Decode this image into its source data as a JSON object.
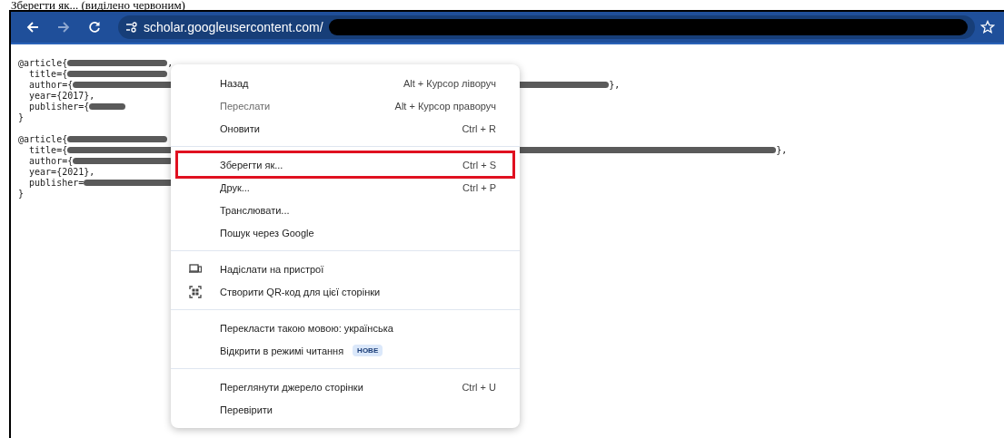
{
  "caption": "Зберегти як... (виділено червоним)",
  "toolbar": {
    "url": "scholar.googleusercontent.com/"
  },
  "code_entries": [
    [
      {
        "prefix": "@article{",
        "redacted": true,
        "suffix": ","
      },
      {
        "prefix": "  title={",
        "redacted": true
      },
      {
        "prefix": "  author={",
        "redacted": true,
        "suffix": "},"
      },
      {
        "prefix": "  year={2017},",
        "redacted": false
      },
      {
        "prefix": "  publisher={",
        "redacted": true
      },
      {
        "prefix": "}",
        "redacted": false
      }
    ],
    [
      {
        "prefix": "@article{",
        "redacted": true
      },
      {
        "prefix": "  title={",
        "redacted": true,
        "suffix": "},"
      },
      {
        "prefix": "  author={",
        "redacted": true
      },
      {
        "prefix": "  year={2021},",
        "redacted": false
      },
      {
        "prefix": "  publisher=",
        "redacted": true
      },
      {
        "prefix": "}",
        "redacted": false
      }
    ]
  ],
  "menu_sections": [
    [
      {
        "label": "Назад",
        "shortcut": "Alt + Курсор ліворуч",
        "disabled": false,
        "highlighted": false
      },
      {
        "label": "Переслати",
        "shortcut": "Alt + Курсор праворуч",
        "disabled": true,
        "highlighted": false
      },
      {
        "label": "Оновити",
        "shortcut": "Ctrl + R",
        "disabled": false,
        "highlighted": false
      }
    ],
    [
      {
        "label": "Зберегти як...",
        "shortcut": "Ctrl + S",
        "disabled": false,
        "highlighted": true
      },
      {
        "label": "Друк...",
        "shortcut": "Ctrl + P",
        "disabled": false,
        "highlighted": false
      },
      {
        "label": "Транслювати...",
        "disabled": false,
        "highlighted": false
      },
      {
        "label": "Пошук через Google",
        "disabled": false,
        "highlighted": false
      }
    ],
    [
      {
        "label": "Надіслати на пристрої",
        "disabled": false,
        "highlighted": false
      },
      {
        "label": "Створити QR-код для цієї сторінки",
        "disabled": false,
        "highlighted": false
      }
    ],
    [
      {
        "label": "Перекласти такою мовою: українська",
        "disabled": false,
        "highlighted": false
      },
      {
        "label": "Відкрити в режимі читання",
        "badge": "НОВЕ",
        "disabled": false,
        "highlighted": false
      }
    ],
    [
      {
        "label": "Переглянути джерело сторінки",
        "shortcut": "Ctrl + U",
        "disabled": false,
        "highlighted": false
      },
      {
        "label": "Перевірити",
        "disabled": false,
        "highlighted": false
      }
    ]
  ]
}
